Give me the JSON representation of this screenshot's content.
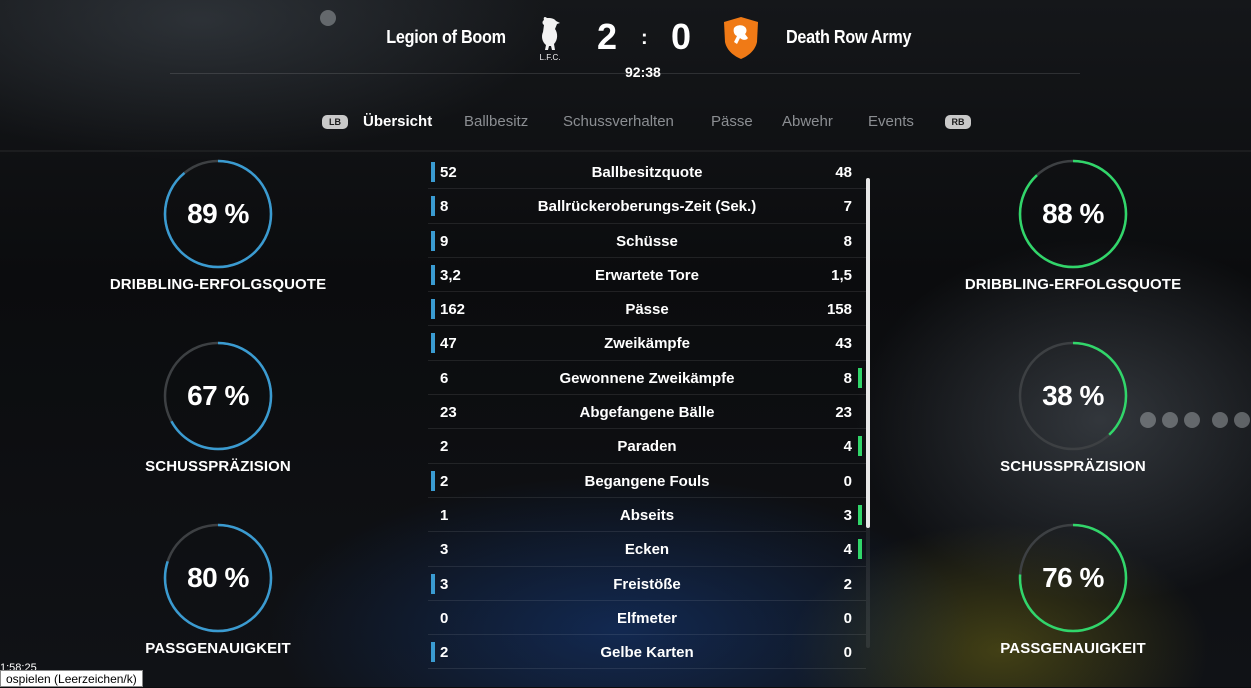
{
  "header": {
    "home_team": "Legion of Boom",
    "away_team": "Death Row Army",
    "home_score": "2",
    "separator": ":",
    "away_score": "0",
    "clock": "92:38",
    "home_crest_text": "L.F.C."
  },
  "tabs": {
    "left_bumper": "LB",
    "right_bumper": "RB",
    "items": [
      "Übersicht",
      "Ballbesitz",
      "Schussverhalten",
      "Pässe",
      "Abwehr",
      "Events"
    ]
  },
  "rings": {
    "home": [
      {
        "value_text": "89 %",
        "value": 89,
        "label": "DRIBBLING-ERFOLGSQUOTE"
      },
      {
        "value_text": "67 %",
        "value": 67,
        "label": "SCHUSSPRÄZISION"
      },
      {
        "value_text": "80 %",
        "value": 80,
        "label": "PASSGENAUIGKEIT"
      }
    ],
    "away": [
      {
        "value_text": "88 %",
        "value": 88,
        "label": "DRIBBLING-ERFOLGSQUOTE"
      },
      {
        "value_text": "38 %",
        "value": 38,
        "label": "SCHUSSPRÄZISION"
      },
      {
        "value_text": "76 %",
        "value": 76,
        "label": "PASSGENAUIGKEIT"
      }
    ]
  },
  "colors": {
    "home": "#3a9bd1",
    "away": "#31d66a",
    "ring_track": "#3d4043"
  },
  "stats": [
    {
      "home": "52",
      "name": "Ballbesitzquote",
      "away": "48",
      "lead": "home"
    },
    {
      "home": "8",
      "name": "Ballrückeroberungs-Zeit (Sek.)",
      "away": "7",
      "lead": "home"
    },
    {
      "home": "9",
      "name": "Schüsse",
      "away": "8",
      "lead": "home"
    },
    {
      "home": "3,2",
      "name": "Erwartete Tore",
      "away": "1,5",
      "lead": "home"
    },
    {
      "home": "162",
      "name": "Pässe",
      "away": "158",
      "lead": "home"
    },
    {
      "home": "47",
      "name": "Zweikämpfe",
      "away": "43",
      "lead": "home"
    },
    {
      "home": "6",
      "name": "Gewonnene Zweikämpfe",
      "away": "8",
      "lead": "away"
    },
    {
      "home": "23",
      "name": "Abgefangene Bälle",
      "away": "23",
      "lead": "none"
    },
    {
      "home": "2",
      "name": "Paraden",
      "away": "4",
      "lead": "away"
    },
    {
      "home": "2",
      "name": "Begangene Fouls",
      "away": "0",
      "lead": "home"
    },
    {
      "home": "1",
      "name": "Abseits",
      "away": "3",
      "lead": "away"
    },
    {
      "home": "3",
      "name": "Ecken",
      "away": "4",
      "lead": "away"
    },
    {
      "home": "3",
      "name": "Freistöße",
      "away": "2",
      "lead": "home"
    },
    {
      "home": "0",
      "name": "Elfmeter",
      "away": "0",
      "lead": "none"
    },
    {
      "home": "2",
      "name": "Gelbe Karten",
      "away": "0",
      "lead": "home"
    }
  ],
  "overlay": {
    "time": "1:58:25",
    "tooltip": "ospielen (Leerzeichen/k)"
  }
}
